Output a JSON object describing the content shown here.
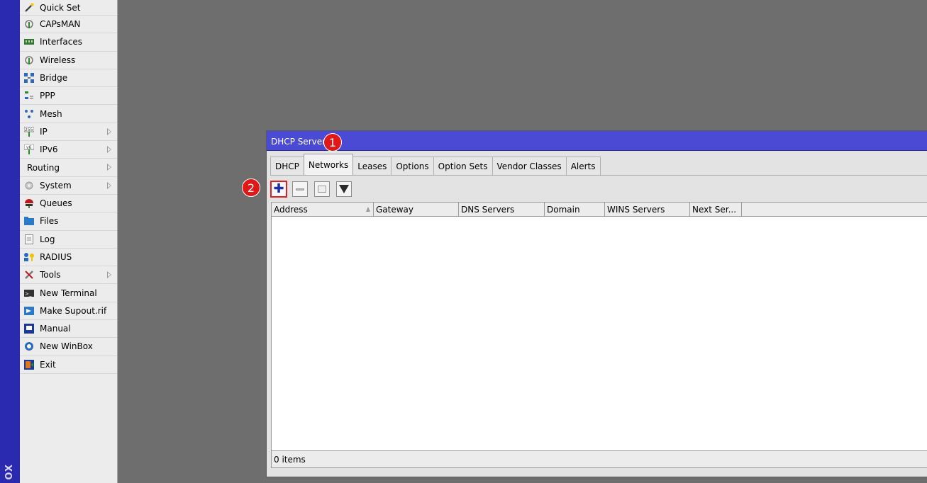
{
  "app": {
    "strip_text": "OX"
  },
  "menu": {
    "items": [
      {
        "label": "Quick Set",
        "icon": "wand-icon"
      },
      {
        "label": "CAPsMAN",
        "icon": "antenna-icon"
      },
      {
        "label": "Interfaces",
        "icon": "interfaces-icon"
      },
      {
        "label": "Wireless",
        "icon": "wireless-icon"
      },
      {
        "label": "Bridge",
        "icon": "bridge-icon"
      },
      {
        "label": "PPP",
        "icon": "ppp-icon"
      },
      {
        "label": "Mesh",
        "icon": "mesh-icon"
      },
      {
        "label": "IP",
        "icon": "ip-icon",
        "submenu": true
      },
      {
        "label": "IPv6",
        "icon": "ipv6-icon",
        "submenu": true
      },
      {
        "label": "Routing",
        "icon": "",
        "submenu": true
      },
      {
        "label": "System",
        "icon": "gear-icon",
        "submenu": true
      },
      {
        "label": "Queues",
        "icon": "queues-icon"
      },
      {
        "label": "Files",
        "icon": "folder-icon"
      },
      {
        "label": "Log",
        "icon": "log-icon"
      },
      {
        "label": "RADIUS",
        "icon": "radius-icon"
      },
      {
        "label": "Tools",
        "icon": "tools-icon",
        "submenu": true
      },
      {
        "label": "New Terminal",
        "icon": "terminal-icon"
      },
      {
        "label": "Make Supout.rif",
        "icon": "supout-icon"
      },
      {
        "label": "Manual",
        "icon": "manual-icon"
      },
      {
        "label": "New WinBox",
        "icon": "winbox-icon"
      },
      {
        "label": "Exit",
        "icon": "exit-icon"
      }
    ]
  },
  "window": {
    "title": "DHCP Server",
    "tabs": [
      {
        "label": "DHCP",
        "active": false
      },
      {
        "label": "Networks",
        "active": true
      },
      {
        "label": "Leases",
        "active": false
      },
      {
        "label": "Options",
        "active": false
      },
      {
        "label": "Option Sets",
        "active": false
      },
      {
        "label": "Vendor Classes",
        "active": false
      },
      {
        "label": "Alerts",
        "active": false
      }
    ],
    "toolbar": {
      "add": "add-icon",
      "remove": "remove-icon",
      "copy": "copy-icon",
      "filter": "filter-icon"
    },
    "columns": [
      "Address",
      "Gateway",
      "DNS Servers",
      "Domain",
      "WINS Servers",
      "Next Ser..."
    ],
    "rows": [],
    "status": "0 items"
  },
  "callouts": {
    "one": "1",
    "two": "2"
  },
  "colors": {
    "title_bar": "#4a4ad4",
    "callout": "#e01818",
    "highlight": "#e02020"
  }
}
